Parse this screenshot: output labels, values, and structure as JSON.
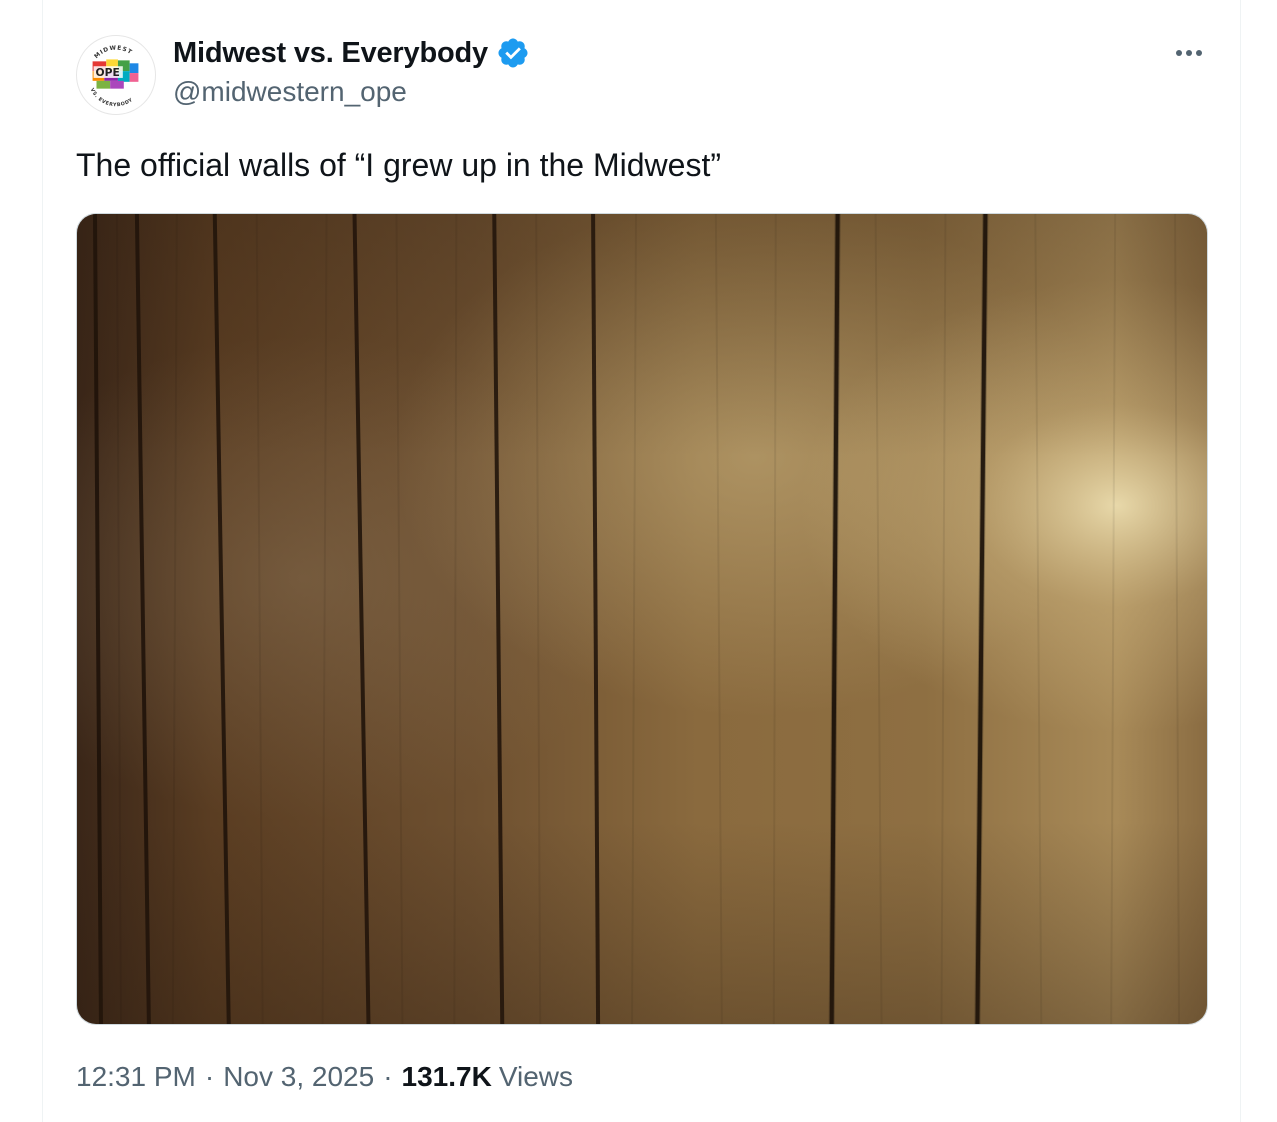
{
  "tweet": {
    "author": {
      "display_name": "Midwest vs. Everybody",
      "handle": "@midwestern_ope",
      "verified": true,
      "avatar_text": {
        "top": "MIDWEST",
        "center": "OPE",
        "bottom": "VS. EVERYBODY"
      }
    },
    "text": "The official walls of “I grew up in the Midwest”",
    "media": {
      "alt": "Wood paneled wall"
    },
    "meta": {
      "time": "12:31 PM",
      "date": "Nov 3, 2025",
      "separator": "·",
      "views_count": "131.7K",
      "views_label": "Views"
    }
  },
  "icons": {
    "verified": "verified-badge-icon",
    "more": "more-options-icon"
  },
  "colors": {
    "verified_blue": "#1d9bf0",
    "text_primary": "#0f1419",
    "text_secondary": "#536471"
  }
}
